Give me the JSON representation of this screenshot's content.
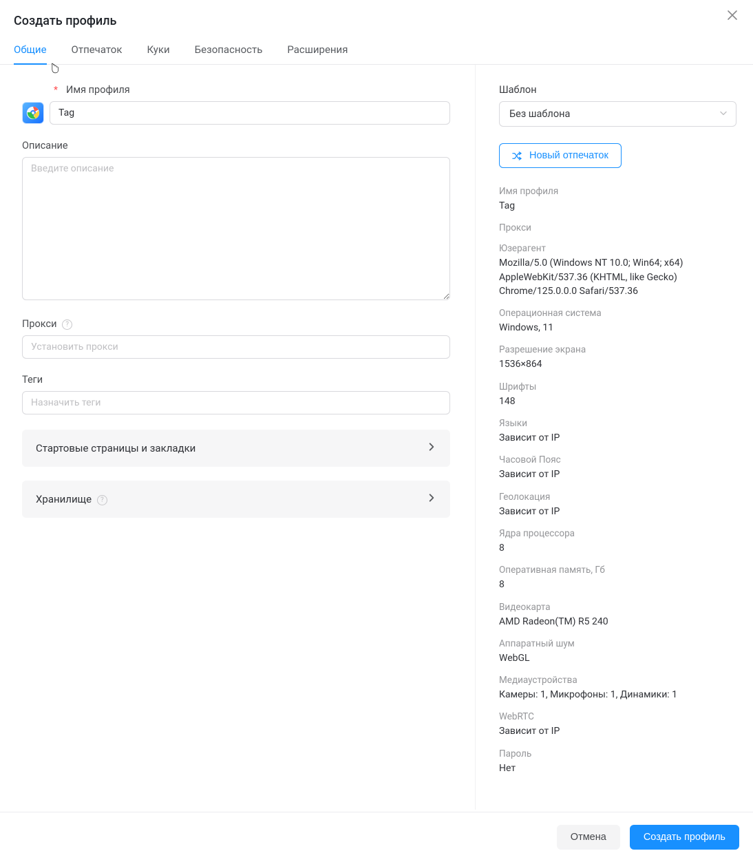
{
  "modal": {
    "title": "Создать профиль"
  },
  "tabs": [
    "Общие",
    "Отпечаток",
    "Куки",
    "Безопасность",
    "Расширения"
  ],
  "form": {
    "name_label": "Имя профиля",
    "name_value": "Tag",
    "desc_label": "Описание",
    "desc_placeholder": "Введите описание",
    "proxy_label": "Прокси",
    "proxy_placeholder": "Установить прокси",
    "tags_label": "Теги",
    "tags_placeholder": "Назначить теги",
    "collapse_start": "Стартовые страницы и закладки",
    "collapse_storage": "Хранилище"
  },
  "sidebar": {
    "template_label": "Шаблон",
    "template_value": "Без шаблона",
    "new_fp_label": "Новый отпечаток",
    "info": [
      {
        "label": "Имя профиля",
        "value": "Tag"
      },
      {
        "label": "Прокси",
        "value": ""
      },
      {
        "label": "Юзерагент",
        "value": "Mozilla/5.0 (Windows NT 10.0; Win64; x64) AppleWebKit/537.36 (KHTML, like Gecko) Chrome/125.0.0.0 Safari/537.36"
      },
      {
        "label": "Операционная система",
        "value": "Windows, 11"
      },
      {
        "label": "Разрешение экрана",
        "value": "1536×864"
      },
      {
        "label": "Шрифты",
        "value": "148"
      },
      {
        "label": "Языки",
        "value": "Зависит от IP"
      },
      {
        "label": "Часовой Пояс",
        "value": "Зависит от IP"
      },
      {
        "label": "Геолокация",
        "value": "Зависит от IP"
      },
      {
        "label": "Ядра процессора",
        "value": "8"
      },
      {
        "label": "Оперативная память, Гб",
        "value": "8"
      },
      {
        "label": "Видеокарта",
        "value": "AMD Radeon(TM) R5 240"
      },
      {
        "label": "Аппаратный шум",
        "value": "WebGL"
      },
      {
        "label": "Медиаустройства",
        "value": "Камеры: 1, Микрофоны: 1, Динамики: 1"
      },
      {
        "label": "WebRTC",
        "value": "Зависит от IP"
      },
      {
        "label": "Пароль",
        "value": "Нет"
      }
    ]
  },
  "footer": {
    "cancel": "Отмена",
    "submit": "Создать профиль"
  }
}
